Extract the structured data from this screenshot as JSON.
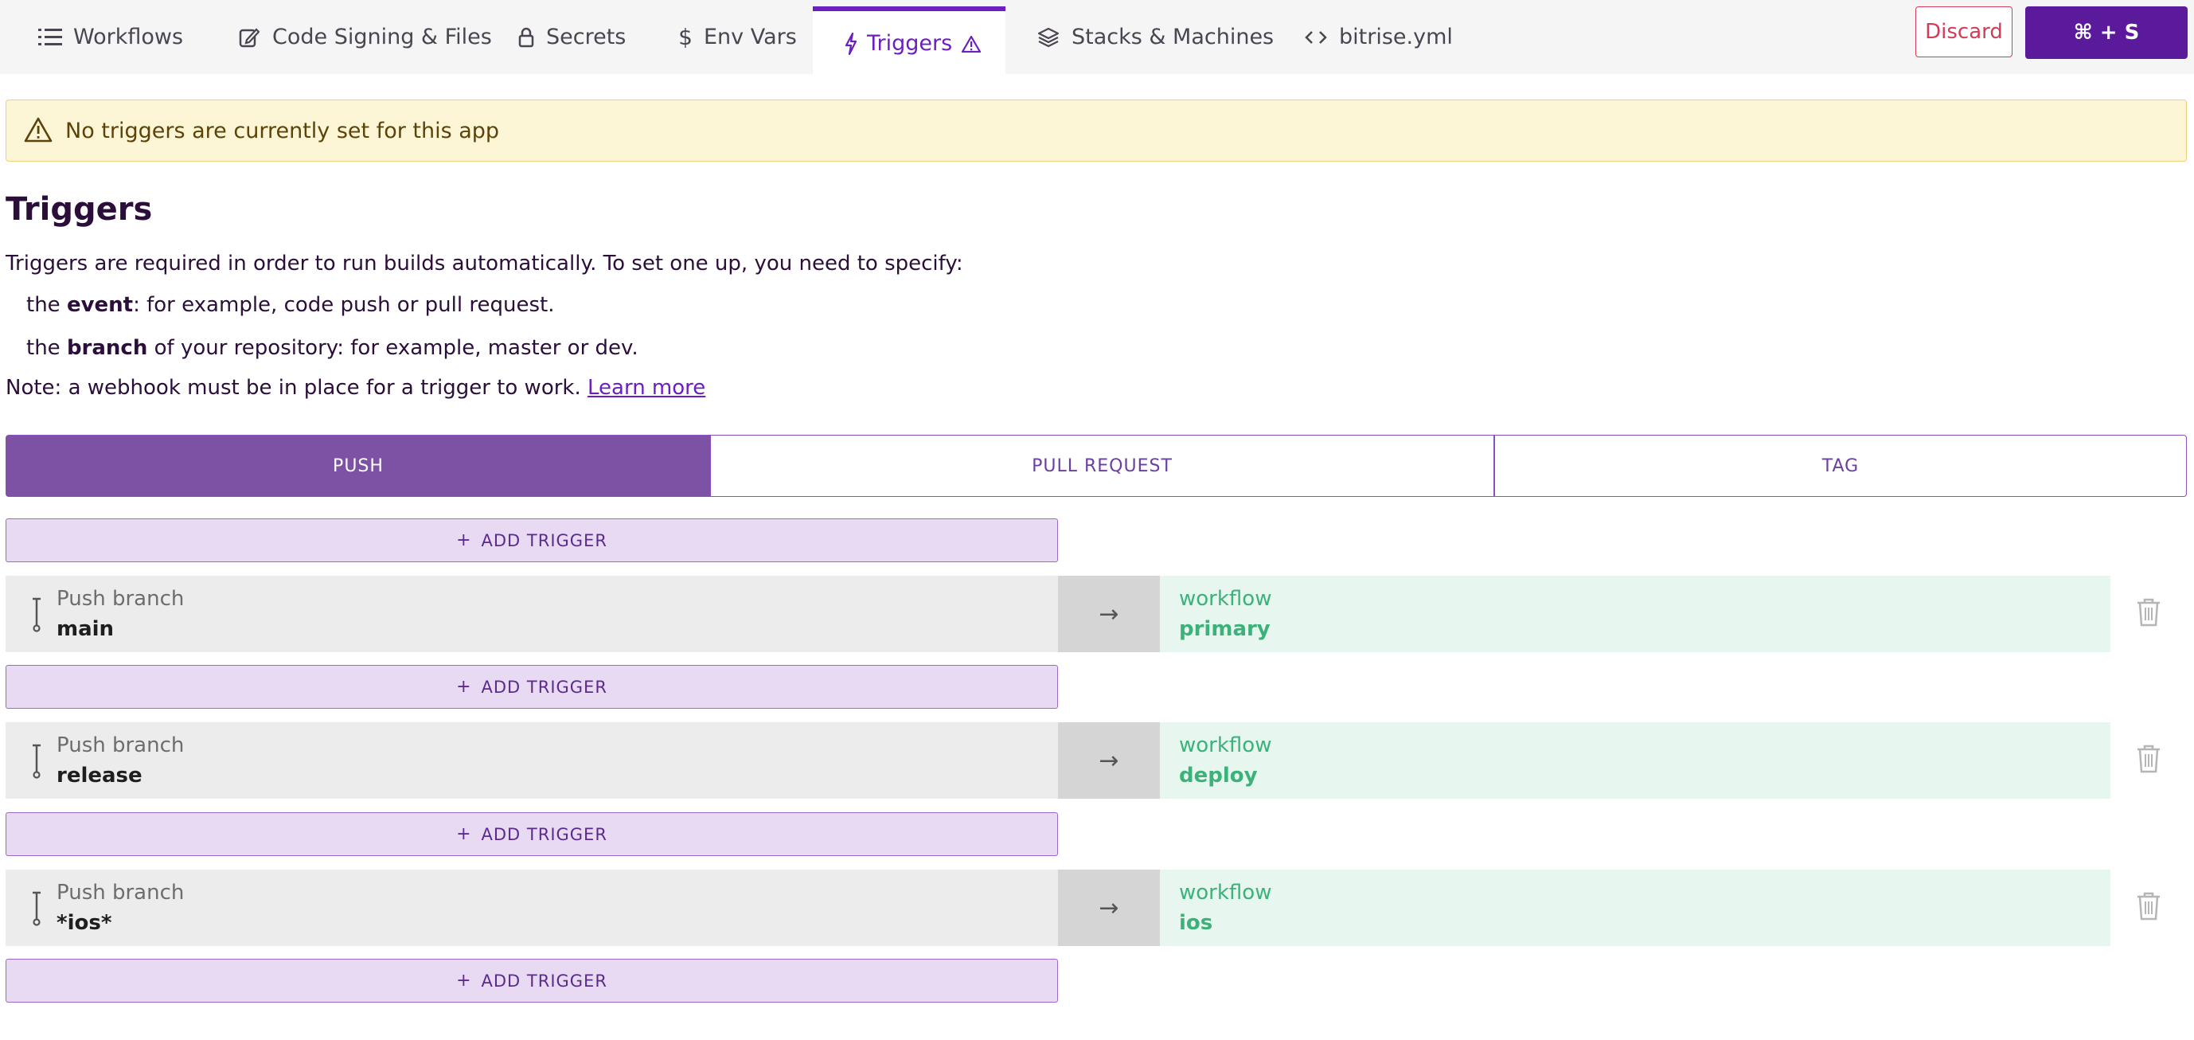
{
  "nav": {
    "tabs": [
      {
        "label": "Workflows",
        "icon": "list-icon"
      },
      {
        "label": "Code Signing & Files",
        "icon": "edit-file-icon"
      },
      {
        "label": "Secrets",
        "icon": "lock-icon"
      },
      {
        "label": "Env Vars",
        "icon": "dollar-icon"
      },
      {
        "label": "Triggers",
        "icon": "lightning-icon",
        "active": true
      },
      {
        "label": "Stacks & Machines",
        "icon": "layers-icon"
      },
      {
        "label": "bitrise.yml",
        "icon": "code-icon"
      }
    ],
    "discard_label": "Discard",
    "save_label": "⌘ + S"
  },
  "alert": {
    "text": "No triggers are currently set for this app"
  },
  "page": {
    "title": "Triggers",
    "intro": "Triggers are required in order to run builds automatically. To set one up, you need to specify:",
    "item1": {
      "prefix": "the",
      "bold": "event",
      "rest": ": for example, code push or pull request."
    },
    "item2": {
      "prefix": "the",
      "bold": "branch",
      "rest": " of your repository: for example, master or dev."
    },
    "note": "Note: a webhook must be in place for a trigger to work.",
    "learn_more": "Learn more"
  },
  "segments": [
    "PUSH",
    "PULL REQUEST",
    "TAG"
  ],
  "add_trigger_label": "ADD TRIGGER",
  "triggers": [
    {
      "type_label": "Push branch",
      "branch": "main",
      "workflow_label": "workflow",
      "workflow": "primary"
    },
    {
      "type_label": "Push branch",
      "branch": "release",
      "workflow_label": "workflow",
      "workflow": "deploy"
    },
    {
      "type_label": "Push branch",
      "branch": "*ios*",
      "workflow_label": "workflow",
      "workflow": "ios"
    }
  ],
  "colors": {
    "accent": "#6b1fc0",
    "save_bg": "#5b1a9c",
    "discard": "#d43b57",
    "segment_active": "#7d52a4",
    "workflow_text": "#3cb27a",
    "warning_bg": "#fcf5d6"
  }
}
